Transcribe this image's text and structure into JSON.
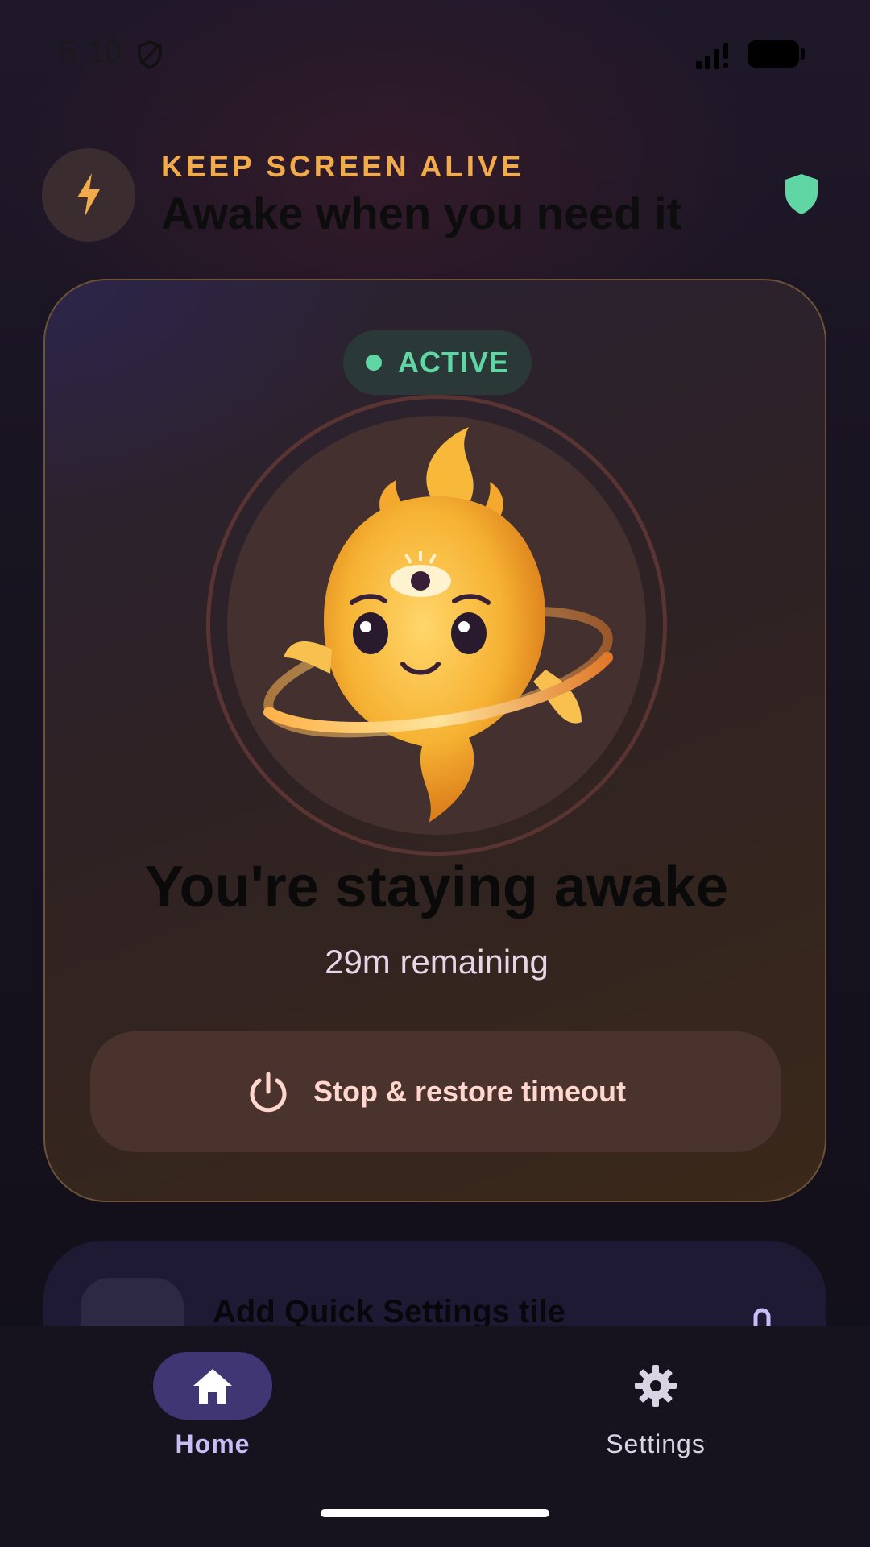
{
  "status_bar": {
    "time": "5:10",
    "icons": [
      "shield-slash-icon",
      "signal-icon",
      "battery-icon"
    ]
  },
  "header": {
    "eyebrow": "KEEP SCREEN ALIVE",
    "title": "Awake when you need it",
    "leading_icon": "lightning-bolt-icon",
    "trailing_icon": "shield-icon"
  },
  "hero": {
    "status": "ACTIVE",
    "title": "You're staying awake",
    "subtitle": "29m remaining",
    "button_label": "Stop & restore timeout",
    "button_icon": "power-icon"
  },
  "quick_settings": {
    "title": "Add Quick Settings tile"
  },
  "nav": {
    "items": [
      {
        "label": "Home",
        "icon": "home-icon",
        "selected": true
      },
      {
        "label": "Settings",
        "icon": "gear-icon",
        "selected": false
      }
    ]
  },
  "colors": {
    "accent_orange": "#f1ab4a",
    "active_green": "#5fd6a3",
    "nav_selected": "#3f3673"
  }
}
